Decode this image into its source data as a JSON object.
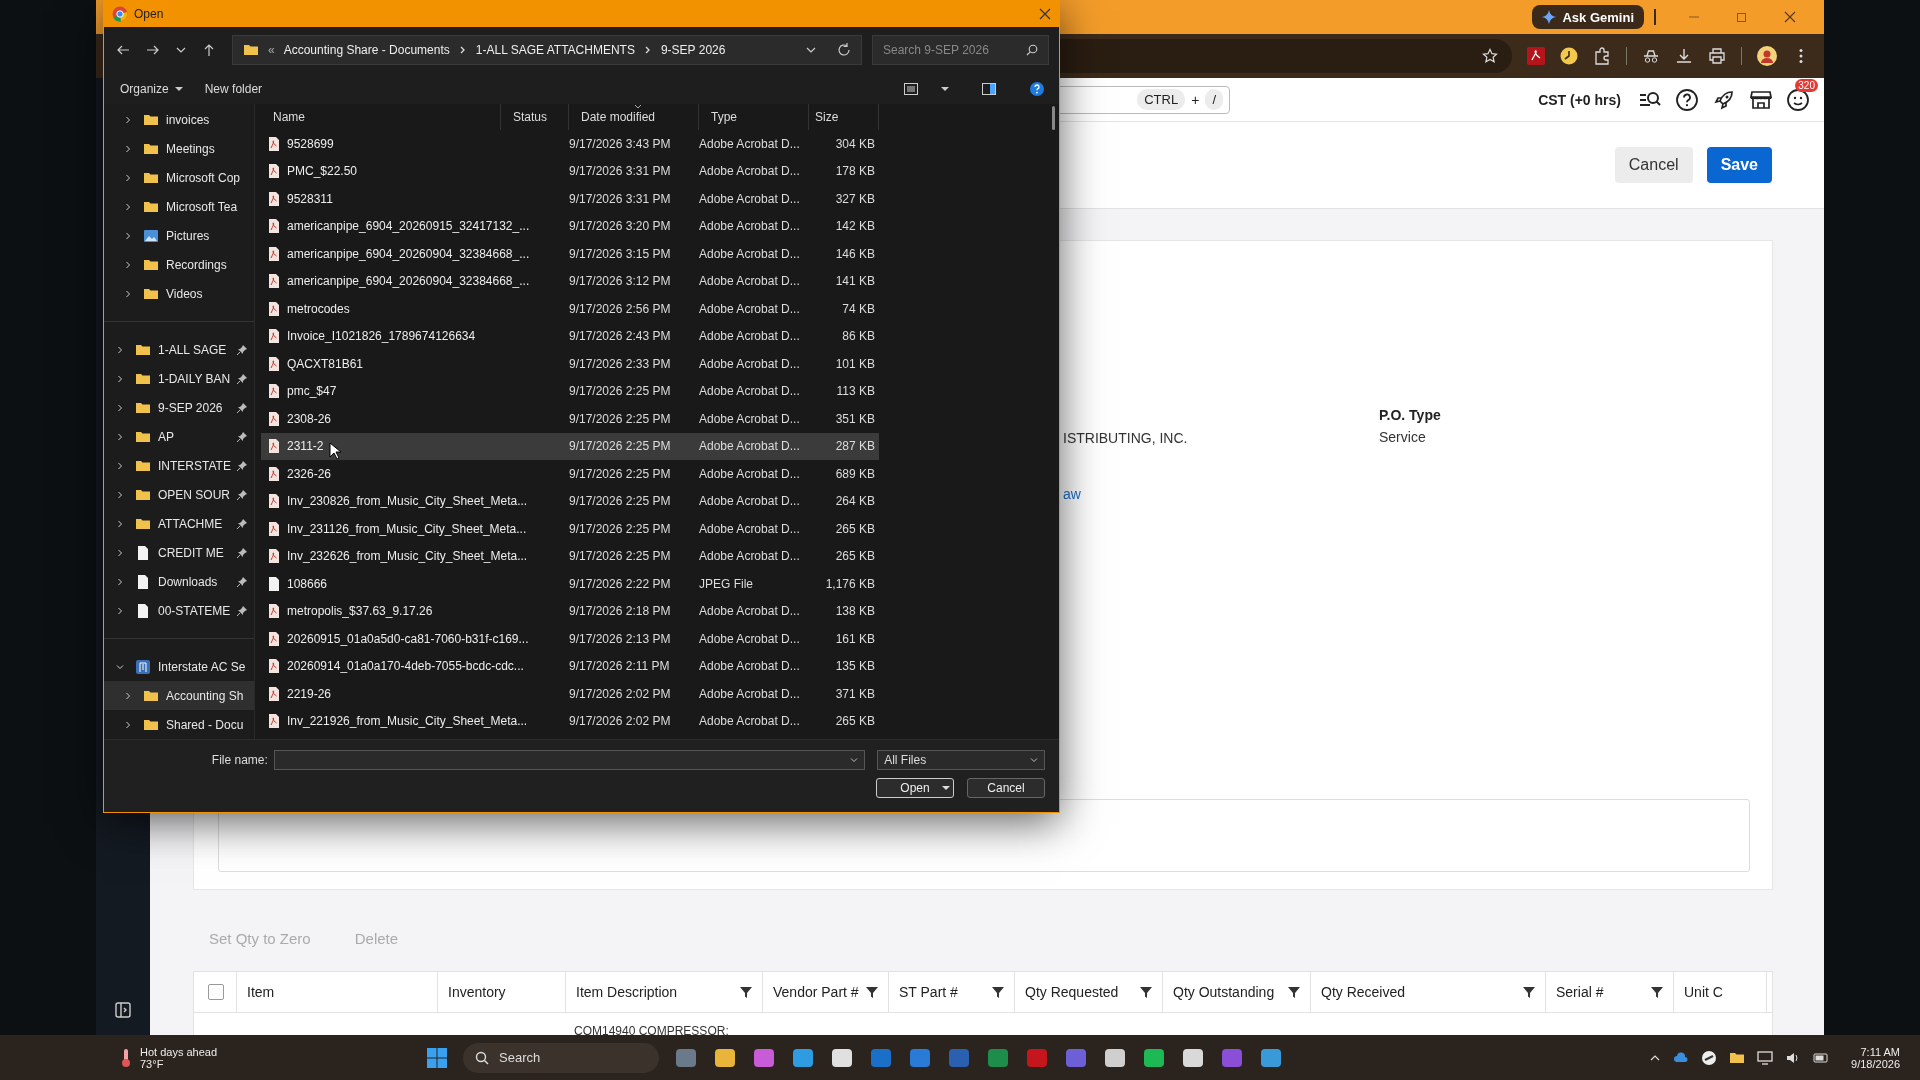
{
  "browser": {
    "ask_gemini": "Ask Gemini",
    "shortcut_keys": [
      "CTRL",
      "/"
    ],
    "shortcut_joiner": "+",
    "timezone": "CST (+0 hrs)",
    "notification_count": "320",
    "header_buttons": [
      {
        "label": "Cancel",
        "kind": "secondary"
      },
      {
        "label": "Save",
        "kind": "primary"
      }
    ],
    "vendor_value": "ISTRIBUTING, INC.",
    "po_type": {
      "label": "P.O. Type",
      "value": "Service"
    },
    "link": "aw",
    "line_actions": [
      {
        "label": "Set Qty to Zero",
        "disabled": true
      },
      {
        "label": "Delete",
        "disabled": true
      }
    ],
    "table": {
      "select_all_checked": false,
      "columns": [
        {
          "label": "Item",
          "filter": false
        },
        {
          "label": "Inventory",
          "filter": false
        },
        {
          "label": "Item Description",
          "filter": true
        },
        {
          "label": "Vendor Part #",
          "filter": true
        },
        {
          "label": "ST Part #",
          "filter": true
        },
        {
          "label": "Qty Requested",
          "filter": true
        },
        {
          "label": "Qty Outstanding",
          "filter": true
        },
        {
          "label": "Qty Received",
          "filter": true
        },
        {
          "label": "Serial #",
          "filter": true
        },
        {
          "label": "Unit C",
          "filter": false
        }
      ],
      "rows": [
        {
          "item_description": "COM14940 COMPRESSOR:"
        }
      ]
    }
  },
  "dialog": {
    "title": "Open",
    "breadcrumb": [
      "Accounting Share - Documents",
      "1-ALL SAGE ATTACHMENTS",
      "9-SEP 2026"
    ],
    "breadcrumb_overflow": "«",
    "search_placeholder": "Search 9-SEP 2026",
    "commands": [
      {
        "label": "Organize",
        "menu": true
      },
      {
        "label": "New folder",
        "menu": false
      }
    ],
    "nav_groups": [
      {
        "kind": "folders",
        "items": [
          {
            "label": "invoices",
            "kind": "folder",
            "expanded": false,
            "selected": false
          },
          {
            "label": "Meetings",
            "kind": "folder",
            "expanded": false,
            "selected": false
          },
          {
            "label": "Microsoft Cop",
            "kind": "folder",
            "expanded": false,
            "selected": false
          },
          {
            "label": "Microsoft Tea",
            "kind": "folder",
            "expanded": false,
            "selected": false
          },
          {
            "label": "Pictures",
            "kind": "pictures",
            "expanded": false,
            "selected": false
          },
          {
            "label": "Recordings",
            "kind": "folder",
            "expanded": false,
            "selected": false
          },
          {
            "label": "Videos",
            "kind": "folder",
            "expanded": false,
            "selected": false
          }
        ]
      },
      {
        "kind": "quick_access",
        "items": [
          {
            "label": "1-ALL SAGE",
            "kind": "folder",
            "pinned": true,
            "expanded": false,
            "selected": false
          },
          {
            "label": "1-DAILY BAN",
            "kind": "folder",
            "pinned": true,
            "expanded": false,
            "selected": false
          },
          {
            "label": "9-SEP 2026",
            "kind": "folder",
            "pinned": true,
            "expanded": false,
            "selected": false
          },
          {
            "label": "AP",
            "kind": "folder",
            "pinned": true,
            "expanded": false,
            "selected": false
          },
          {
            "label": "INTERSTATE",
            "kind": "folder",
            "pinned": true,
            "expanded": false,
            "selected": false
          },
          {
            "label": "OPEN SOUR",
            "kind": "folder",
            "pinned": true,
            "expanded": false,
            "selected": false
          },
          {
            "label": "ATTACHME",
            "kind": "folder",
            "pinned": true,
            "expanded": false,
            "selected": false
          },
          {
            "label": "CREDIT ME",
            "kind": "document",
            "pinned": true,
            "expanded": false,
            "selected": false
          },
          {
            "label": "Downloads",
            "kind": "document",
            "pinned": true,
            "expanded": false,
            "selected": false
          },
          {
            "label": "00-STATEME",
            "kind": "document",
            "pinned": true,
            "expanded": false,
            "selected": false
          }
        ]
      },
      {
        "kind": "tree",
        "items": [
          {
            "label": "Interstate AC Se",
            "kind": "cloud",
            "expanded": true,
            "selected": false,
            "children": [
              {
                "label": "Accounting Sh",
                "kind": "folder",
                "expanded": false,
                "selected": true
              },
              {
                "label": "Shared - Docu",
                "kind": "folder",
                "expanded": false,
                "selected": false
              }
            ]
          }
        ]
      }
    ],
    "columns": [
      {
        "label": "Name",
        "sorted": false
      },
      {
        "label": "Status",
        "sorted": false
      },
      {
        "label": "Date modified",
        "sorted": true
      },
      {
        "label": "Type",
        "sorted": false
      },
      {
        "label": "Size",
        "sorted": false
      }
    ],
    "files": [
      {
        "name": "9528699",
        "date": "9/17/2026 3:43 PM",
        "type": "Adobe Acrobat D...",
        "size": "304 KB",
        "kind": "pdf",
        "selected": false
      },
      {
        "name": "PMC_$22.50",
        "date": "9/17/2026 3:31 PM",
        "type": "Adobe Acrobat D...",
        "size": "178 KB",
        "kind": "pdf",
        "selected": false
      },
      {
        "name": "9528311",
        "date": "9/17/2026 3:31 PM",
        "type": "Adobe Acrobat D...",
        "size": "327 KB",
        "kind": "pdf",
        "selected": false
      },
      {
        "name": "americanpipe_6904_20260915_32417132_...",
        "date": "9/17/2026 3:20 PM",
        "type": "Adobe Acrobat D...",
        "size": "142 KB",
        "kind": "pdf",
        "selected": false
      },
      {
        "name": "americanpipe_6904_20260904_32384668_...",
        "date": "9/17/2026 3:15 PM",
        "type": "Adobe Acrobat D...",
        "size": "146 KB",
        "kind": "pdf",
        "selected": false
      },
      {
        "name": "americanpipe_6904_20260904_32384668_...",
        "date": "9/17/2026 3:12 PM",
        "type": "Adobe Acrobat D...",
        "size": "141 KB",
        "kind": "pdf",
        "selected": false
      },
      {
        "name": "metrocodes",
        "date": "9/17/2026 2:56 PM",
        "type": "Adobe Acrobat D...",
        "size": "74 KB",
        "kind": "pdf",
        "selected": false
      },
      {
        "name": "Invoice_I1021826_1789674126634",
        "date": "9/17/2026 2:43 PM",
        "type": "Adobe Acrobat D...",
        "size": "86 KB",
        "kind": "pdf",
        "selected": false
      },
      {
        "name": "QACXT81B61",
        "date": "9/17/2026 2:33 PM",
        "type": "Adobe Acrobat D...",
        "size": "101 KB",
        "kind": "pdf",
        "selected": false
      },
      {
        "name": "pmc_$47",
        "date": "9/17/2026 2:25 PM",
        "type": "Adobe Acrobat D...",
        "size": "113 KB",
        "kind": "pdf",
        "selected": false
      },
      {
        "name": "2308-26",
        "date": "9/17/2026 2:25 PM",
        "type": "Adobe Acrobat D...",
        "size": "351 KB",
        "kind": "pdf",
        "selected": false
      },
      {
        "name": "2311-2",
        "date": "9/17/2026 2:25 PM",
        "type": "Adobe Acrobat D...",
        "size": "287 KB",
        "kind": "pdf",
        "selected": true
      },
      {
        "name": "2326-26",
        "date": "9/17/2026 2:25 PM",
        "type": "Adobe Acrobat D...",
        "size": "689 KB",
        "kind": "pdf",
        "selected": false
      },
      {
        "name": "Inv_230826_from_Music_City_Sheet_Meta...",
        "date": "9/17/2026 2:25 PM",
        "type": "Adobe Acrobat D...",
        "size": "264 KB",
        "kind": "pdf",
        "selected": false
      },
      {
        "name": "Inv_231126_from_Music_City_Sheet_Meta...",
        "date": "9/17/2026 2:25 PM",
        "type": "Adobe Acrobat D...",
        "size": "265 KB",
        "kind": "pdf",
        "selected": false
      },
      {
        "name": "Inv_232626_from_Music_City_Sheet_Meta...",
        "date": "9/17/2026 2:25 PM",
        "type": "Adobe Acrobat D...",
        "size": "265 KB",
        "kind": "pdf",
        "selected": false
      },
      {
        "name": "108666",
        "date": "9/17/2026 2:22 PM",
        "type": "JPEG File",
        "size": "1,176 KB",
        "kind": "file",
        "selected": false
      },
      {
        "name": "metropolis_$37.63_9.17.26",
        "date": "9/17/2026 2:18 PM",
        "type": "Adobe Acrobat D...",
        "size": "138 KB",
        "kind": "pdf",
        "selected": false
      },
      {
        "name": "20260915_01a0a5d0-ca81-7060-b31f-c169...",
        "date": "9/17/2026 2:13 PM",
        "type": "Adobe Acrobat D...",
        "size": "161 KB",
        "kind": "pdf",
        "selected": false
      },
      {
        "name": "20260914_01a0a170-4deb-7055-bcdc-cdc...",
        "date": "9/17/2026 2:11 PM",
        "type": "Adobe Acrobat D...",
        "size": "135 KB",
        "kind": "pdf",
        "selected": false
      },
      {
        "name": "2219-26",
        "date": "9/17/2026 2:02 PM",
        "type": "Adobe Acrobat D...",
        "size": "371 KB",
        "kind": "pdf",
        "selected": false
      },
      {
        "name": "Inv_221926_from_Music_City_Sheet_Meta...",
        "date": "9/17/2026 2:02 PM",
        "type": "Adobe Acrobat D...",
        "size": "265 KB",
        "kind": "pdf",
        "selected": false
      }
    ],
    "file_name_label": "File name:",
    "file_type": "All Files",
    "buttons": [
      {
        "label": "Open",
        "kind": "split"
      },
      {
        "label": "Cancel",
        "kind": "plain"
      }
    ]
  },
  "taskbar": {
    "weather": {
      "title": "Hot days ahead",
      "temp": "73°F"
    },
    "search_placeholder": "Search",
    "time": "7:11 AM",
    "date": "9/18/2026"
  }
}
